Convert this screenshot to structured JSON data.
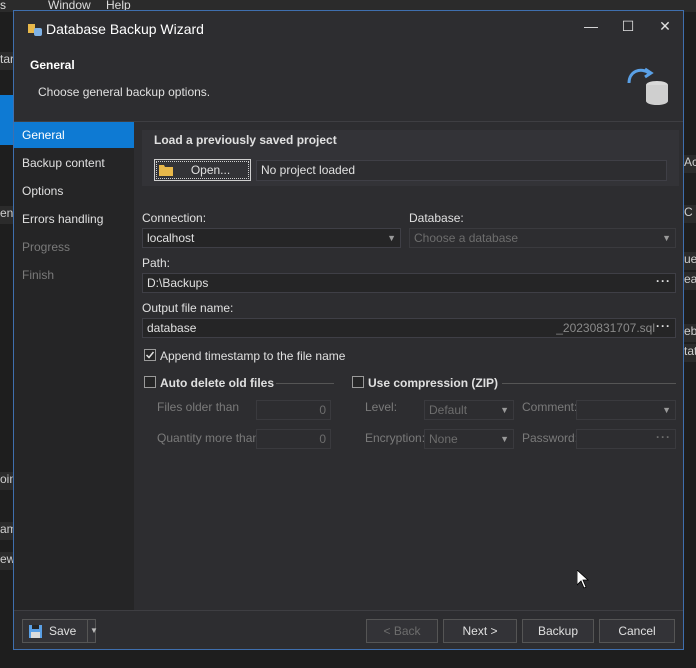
{
  "bg_app": {
    "menu": [
      "s",
      "Window",
      "Help"
    ],
    "frag_left": [
      "tar",
      "en",
      "oin",
      "ame",
      "ew"
    ],
    "frag_right": [
      "Ac",
      "C",
      "ue",
      "eat",
      "eb",
      "tat"
    ]
  },
  "dialog": {
    "title": "Database Backup Wizard",
    "minimize": "—",
    "maximize": "☐",
    "close": "✕",
    "header_title": "General",
    "header_desc": "Choose general backup options."
  },
  "sidebar": {
    "items": [
      {
        "label": "General",
        "state": "active"
      },
      {
        "label": "Backup content",
        "state": "normal"
      },
      {
        "label": "Options",
        "state": "normal"
      },
      {
        "label": "Errors handling",
        "state": "normal"
      },
      {
        "label": "Progress",
        "state": "disabled"
      },
      {
        "label": "Finish",
        "state": "disabled"
      }
    ]
  },
  "load_project": {
    "heading": "Load a previously saved project",
    "open_label": "Open...",
    "status": "No project loaded"
  },
  "connection": {
    "label": "Connection:",
    "value": "localhost"
  },
  "database": {
    "label": "Database:",
    "placeholder": "Choose a database"
  },
  "path": {
    "label": "Path:",
    "value": "D:\\Backups"
  },
  "output": {
    "label": "Output file name:",
    "value": "database",
    "suffix": "_20230831707.sql"
  },
  "append_timestamp": {
    "label": "Append timestamp to the file name",
    "checked": true
  },
  "auto_delete": {
    "label": "Auto delete old files",
    "checked": false,
    "files_older_label": "Files older than",
    "files_older_value": "0",
    "quantity_label": "Quantity more than",
    "quantity_value": "0"
  },
  "compression": {
    "label": "Use compression (ZIP)",
    "checked": false,
    "level_label": "Level:",
    "level_value": "Default",
    "comment_label": "Comment:",
    "encryption_label": "Encryption:",
    "encryption_value": "None",
    "password_label": "Password:"
  },
  "footer": {
    "save": "Save",
    "back": "< Back",
    "next": "Next >",
    "backup": "Backup",
    "cancel": "Cancel"
  },
  "colors": {
    "accent": "#0e7ad3",
    "border": "#3f6fae"
  }
}
